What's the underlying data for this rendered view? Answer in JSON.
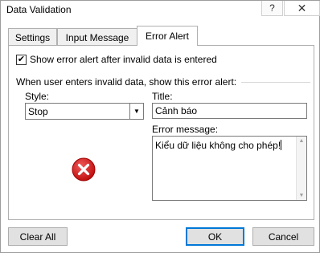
{
  "window": {
    "title": "Data Validation",
    "help_label": "?",
    "close_label": "✕"
  },
  "tabs": [
    {
      "label": "Settings"
    },
    {
      "label": "Input Message"
    },
    {
      "label": "Error Alert"
    }
  ],
  "error_alert": {
    "show_alert_label": "Show error alert after invalid data is entered",
    "show_alert_checked": true,
    "section_label": "When user enters invalid data, show this error alert:",
    "style_label": "Style:",
    "style_value": "Stop",
    "title_label": "Title:",
    "title_value": "Cảnh báo",
    "message_label": "Error message:",
    "message_value": "Kiểu dữ liệu không cho phép!",
    "icon": "stop-icon"
  },
  "buttons": {
    "clear_all": "Clear All",
    "ok": "OK",
    "cancel": "Cancel"
  },
  "colors": {
    "stop_red": "#d61d1d",
    "default_button_border": "#0078d7"
  }
}
